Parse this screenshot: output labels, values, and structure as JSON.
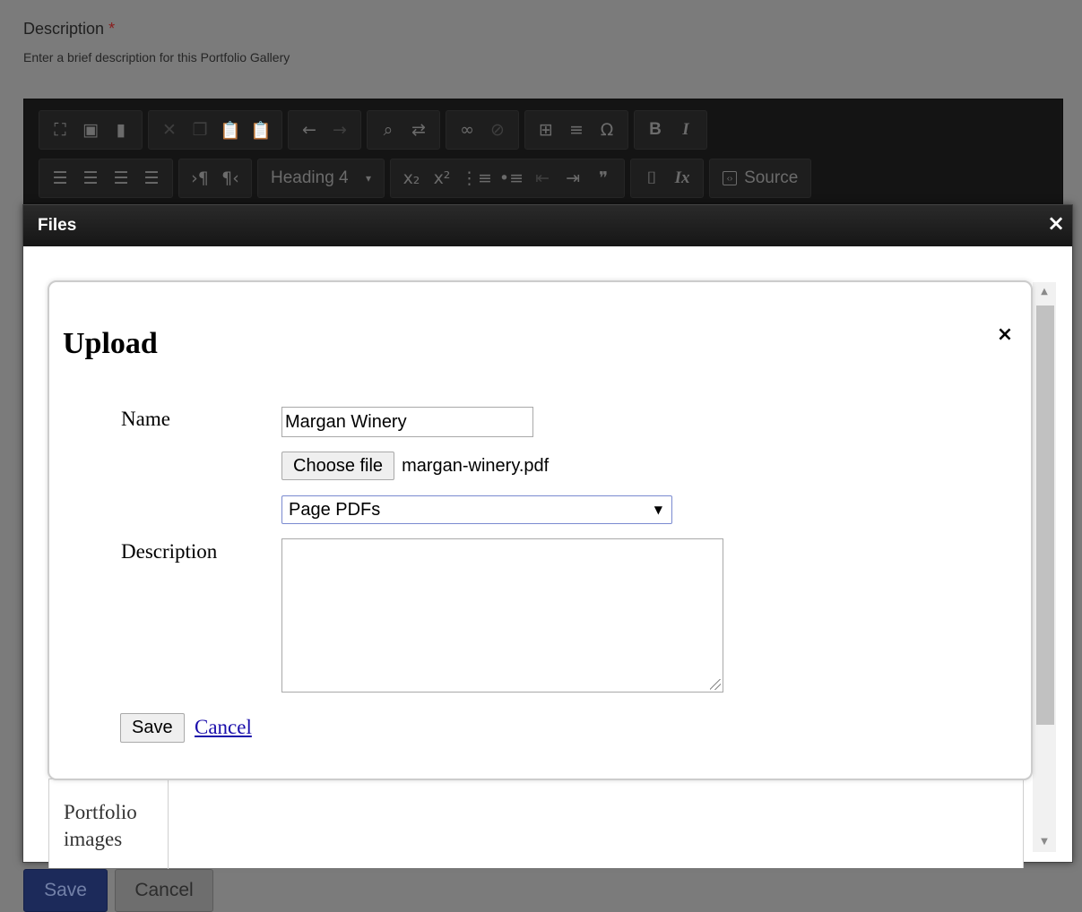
{
  "form": {
    "description_label": "Description",
    "required_marker": "*",
    "description_help": "Enter a brief description for this Portfolio Gallery"
  },
  "editor_toolbar": {
    "row1": [
      [
        {
          "icon": "maximize-icon",
          "glyph": "⛶"
        },
        {
          "icon": "image-icon",
          "glyph": "▣"
        },
        {
          "icon": "document-icon",
          "glyph": "▮"
        }
      ],
      [
        {
          "icon": "cut-icon",
          "glyph": "✕",
          "dim": true
        },
        {
          "icon": "copy-icon",
          "glyph": "❐",
          "dim": true
        },
        {
          "icon": "paste-text-icon",
          "glyph": "📋"
        },
        {
          "icon": "paste-word-icon",
          "glyph": "📋"
        }
      ],
      [
        {
          "icon": "undo-icon",
          "glyph": "←"
        },
        {
          "icon": "redo-icon",
          "glyph": "→",
          "dim": true
        }
      ],
      [
        {
          "icon": "find-icon",
          "glyph": "⌕"
        },
        {
          "icon": "replace-icon",
          "glyph": "⇄"
        }
      ],
      [
        {
          "icon": "link-icon",
          "glyph": "∞"
        },
        {
          "icon": "unlink-icon",
          "glyph": "⊘",
          "dim": true
        }
      ],
      [
        {
          "icon": "table-icon",
          "glyph": "⊞"
        },
        {
          "icon": "horizontal-rule-icon",
          "glyph": "≡"
        },
        {
          "icon": "special-char-icon",
          "glyph": "Ω"
        }
      ],
      [
        {
          "icon": "bold-icon",
          "glyph": "B",
          "style": "bold"
        },
        {
          "icon": "italic-icon",
          "glyph": "I",
          "style": "ital"
        }
      ]
    ],
    "row2_align": [
      [
        {
          "icon": "align-left-icon",
          "glyph": "☰"
        },
        {
          "icon": "align-center-icon",
          "glyph": "☰"
        },
        {
          "icon": "align-right-icon",
          "glyph": "☰"
        },
        {
          "icon": "justify-icon",
          "glyph": "☰"
        }
      ],
      [
        {
          "icon": "ltr-icon",
          "glyph": "›¶"
        },
        {
          "icon": "rtl-icon",
          "glyph": "¶‹"
        }
      ]
    ],
    "format_combo": "Heading 4",
    "row2_rest": [
      [
        {
          "icon": "subscript-icon",
          "glyph": "x₂"
        },
        {
          "icon": "superscript-icon",
          "glyph": "x²"
        },
        {
          "icon": "numbered-list-icon",
          "glyph": "⋮≡"
        },
        {
          "icon": "bulleted-list-icon",
          "glyph": "•≡"
        },
        {
          "icon": "outdent-icon",
          "glyph": "⇤",
          "dim": true
        },
        {
          "icon": "indent-icon",
          "glyph": "⇥"
        },
        {
          "icon": "blockquote-icon",
          "glyph": "❞"
        }
      ],
      [
        {
          "icon": "create-div-icon",
          "glyph": "⌷"
        },
        {
          "icon": "remove-format-icon",
          "glyph": "Ix",
          "style": "ital"
        }
      ]
    ],
    "source_label": "Source"
  },
  "files_modal": {
    "title": "Files",
    "close_glyph": "×"
  },
  "upload": {
    "title": "Upload",
    "close_glyph": "×",
    "name_label": "Name",
    "name_value": "Margan Winery",
    "choose_file_label": "Choose file",
    "file_name": "margan-winery.pdf",
    "folder_selected": "Page PDFs",
    "description_label": "Description",
    "save_label": "Save",
    "cancel_label": "Cancel"
  },
  "background_table": {
    "label_line1": "Portfolio",
    "label_line2": "images"
  },
  "page_buttons": {
    "save": "Save",
    "cancel": "Cancel"
  }
}
